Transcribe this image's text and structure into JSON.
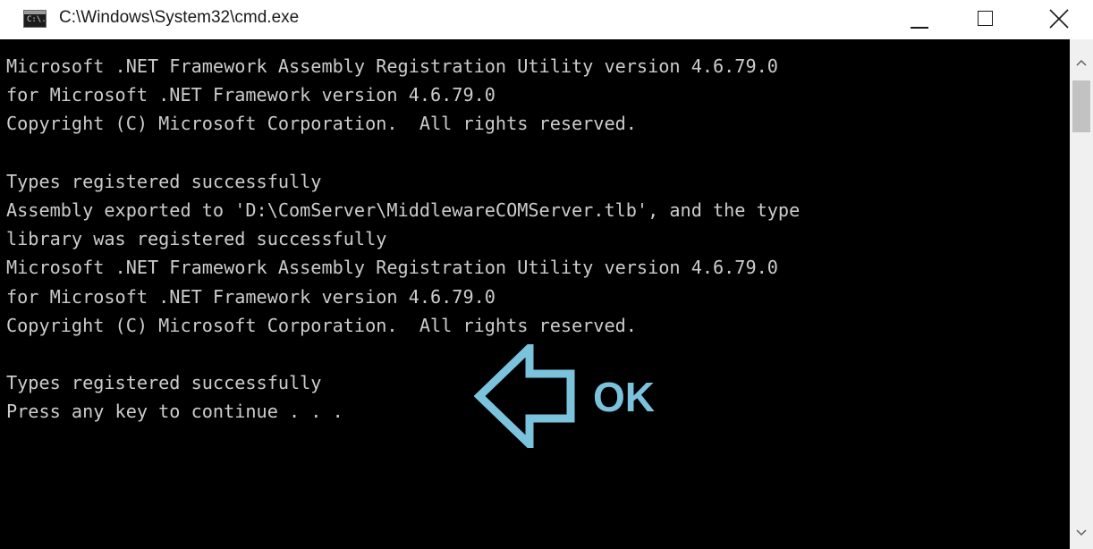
{
  "window": {
    "title": "C:\\Windows\\System32\\cmd.exe",
    "icon": "cmd-icon",
    "icon_text": "C:\\.",
    "controls": [
      "minimize-icon",
      "maximize-icon",
      "close-icon"
    ]
  },
  "console": {
    "lines": [
      "Microsoft .NET Framework Assembly Registration Utility version 4.6.79.0",
      "for Microsoft .NET Framework version 4.6.79.0",
      "Copyright (C) Microsoft Corporation.  All rights reserved.",
      "",
      "Types registered successfully",
      "Assembly exported to 'D:\\ComServer\\MiddlewareCOMServer.tlb', and the type",
      "library was registered successfully",
      "Microsoft .NET Framework Assembly Registration Utility version 4.6.79.0",
      "for Microsoft .NET Framework version 4.6.79.0",
      "Copyright (C) Microsoft Corporation.  All rights reserved.",
      "",
      "Types registered successfully",
      "Press any key to continue . . ."
    ],
    "background": "#000000",
    "text_color": "#cccccc"
  },
  "annotation": {
    "label": "OK",
    "arrow_icon": "left-arrow-icon",
    "color": "#7bc3dc"
  },
  "scrollbar": {
    "up_icon": "scroll-up-icon",
    "down_icon": "scroll-down-icon"
  }
}
